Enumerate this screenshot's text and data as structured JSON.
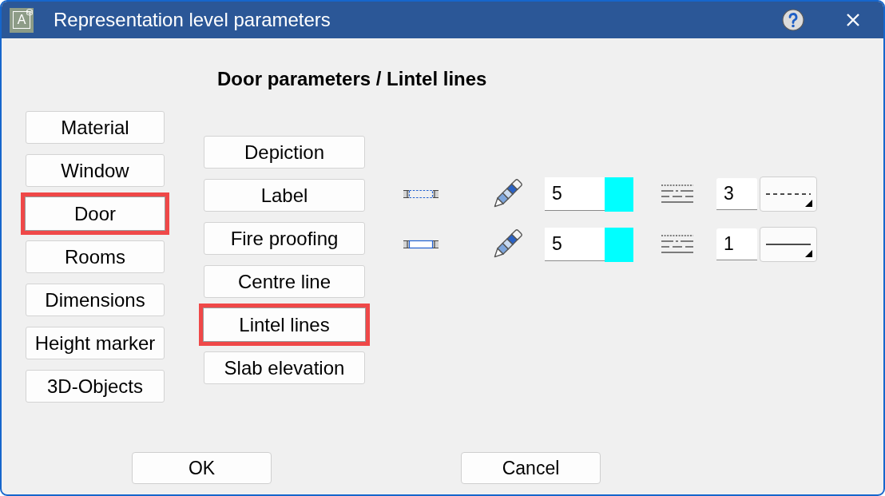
{
  "window": {
    "title": "Representation level parameters",
    "logo_letter": "A"
  },
  "heading": "Door parameters / Lintel lines",
  "categories": [
    {
      "label": "Material",
      "selected": false
    },
    {
      "label": "Window",
      "selected": false
    },
    {
      "label": "Door",
      "selected": true
    },
    {
      "label": "Rooms",
      "selected": false
    },
    {
      "label": "Dimensions",
      "selected": false
    },
    {
      "label": "Height marker",
      "selected": false
    },
    {
      "label": "3D-Objects",
      "selected": false
    }
  ],
  "subcategories": [
    {
      "label": "Depiction",
      "selected": false
    },
    {
      "label": "Label",
      "selected": false
    },
    {
      "label": "Fire proofing",
      "selected": false
    },
    {
      "label": "Centre line",
      "selected": false
    },
    {
      "label": "Lintel lines",
      "selected": true
    },
    {
      "label": "Slab elevation",
      "selected": false
    }
  ],
  "line_rows": [
    {
      "kind": "dashed",
      "pen": "5",
      "color": "#00ffff",
      "line_type": "3"
    },
    {
      "kind": "solid",
      "pen": "5",
      "color": "#00ffff",
      "line_type": "1"
    }
  ],
  "buttons": [
    {
      "label": "OK"
    },
    {
      "label": "Cancel"
    }
  ]
}
